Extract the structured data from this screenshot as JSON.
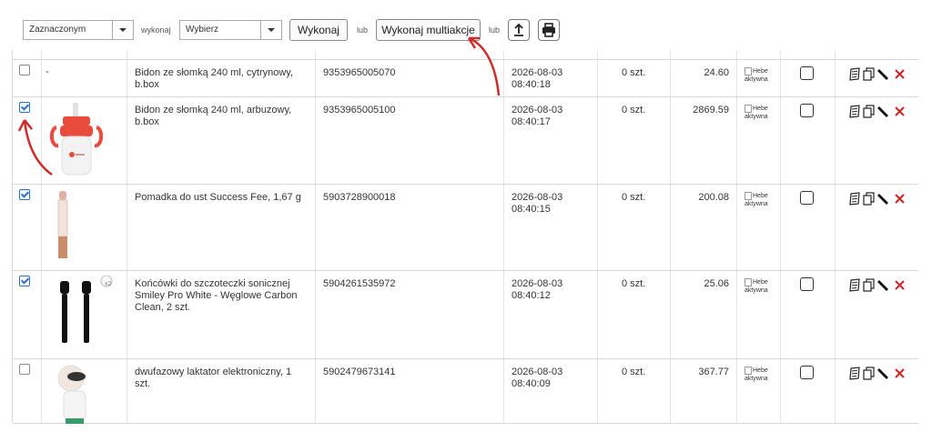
{
  "toolbar": {
    "scope_select": "Zaznaczonym",
    "label_perform": "wykonaj",
    "action_select": "Wybierz",
    "execute_button": "Wykonaj",
    "or_1": "lub",
    "multi_button": "Wykonaj multiakcje",
    "or_2": "lub"
  },
  "rows": [
    {
      "checked": false,
      "image": "",
      "thumb_text": "-",
      "name": "Bidon ze słomką 240 ml, cytrynowy, b.box",
      "ean": "9353965005070",
      "date": "2026-08-03",
      "time": "08:40:18",
      "qty": "0 szt.",
      "price": "24.60",
      "status_alt": "Hebe",
      "status": "aktywna"
    },
    {
      "checked": true,
      "image": "bottle",
      "thumb_text": "",
      "name": "Bidon ze słomką 240 ml, arbuzowy, b.box",
      "ean": "9353965005100",
      "date": "2026-08-03",
      "time": "08:40:17",
      "qty": "0 szt.",
      "price": "2869.59",
      "status_alt": "Hebe",
      "status": "aktywna"
    },
    {
      "checked": true,
      "image": "lipstick",
      "thumb_text": "",
      "name": "Pomadka do ust Success Fee, 1,67 g",
      "ean": "5903728900018",
      "date": "2026-08-03",
      "time": "08:40:15",
      "qty": "0 szt.",
      "price": "200.08",
      "status_alt": "Hebe",
      "status": "aktywna"
    },
    {
      "checked": true,
      "image": "brushheads",
      "thumb_text": "x2",
      "name": "Końcówki do szczoteczki sonicznej Smiley Pro White - Węglowe Carbon Clean, 2 szt.",
      "ean": "5904261535972",
      "date": "2026-08-03",
      "time": "08:40:12",
      "qty": "0 szt.",
      "price": "25.06",
      "status_alt": "Hebe",
      "status": "aktywna"
    },
    {
      "checked": false,
      "image": "pump",
      "thumb_text": "",
      "name": "dwufazowy laktator elektroniczny, 1 szt.",
      "ean": "5902479673141",
      "date": "2026-08-03",
      "time": "08:40:09",
      "qty": "0 szt.",
      "price": "367.77",
      "status_alt": "Hebe",
      "status": "aktywna"
    }
  ],
  "colors": {
    "accent": "#2a6ecf",
    "delete": "#d22222",
    "annotation": "#d12a2a"
  }
}
